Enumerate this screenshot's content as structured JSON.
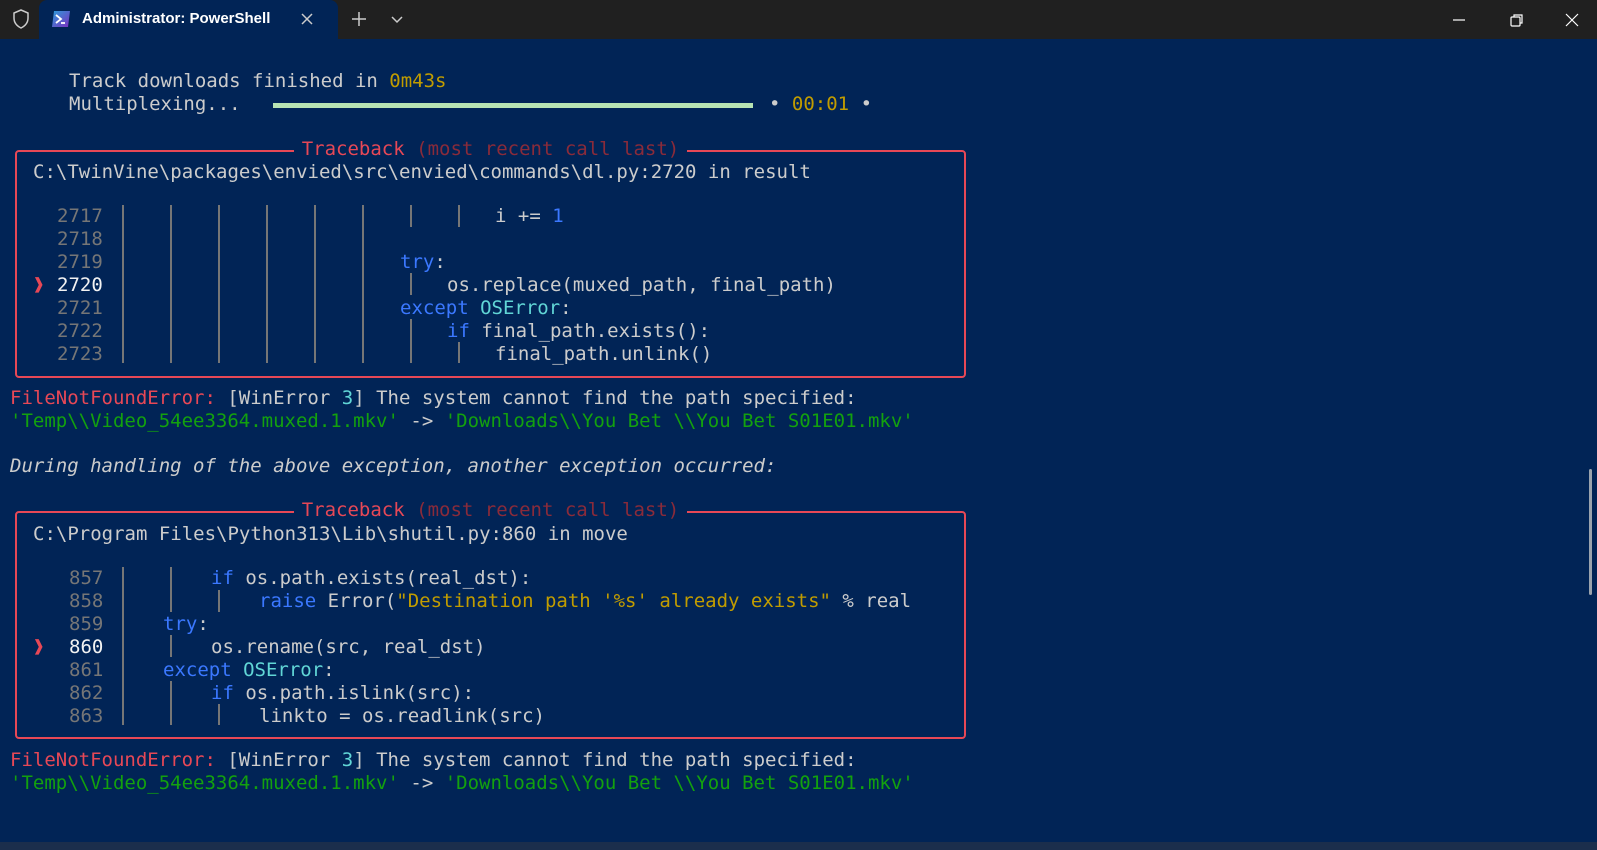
{
  "window": {
    "tab_title": "Administrator: PowerShell",
    "icons": {
      "shield": "shield-icon",
      "app": "powershell-icon",
      "close_tab": "close-icon",
      "new_tab": "plus-icon",
      "dropdown": "chevron-down-icon",
      "minimize": "minimize-icon",
      "restore": "restore-icon",
      "close_window": "close-icon"
    }
  },
  "colors": {
    "background": "#012456",
    "titlebar": "#202020",
    "error_red": "#e74856",
    "keyword_blue": "#3b78ff",
    "string_green": "#13a10e",
    "number_yellow": "#c19c00",
    "progress_fill": "#b7e4b3"
  },
  "output": {
    "track_downloads_prefix": "Track downloads finished in ",
    "track_downloads_time": "0m43s",
    "multiplexing_label": "Multiplexing...",
    "progress_percent": 100,
    "progress_bullet_left": "•",
    "progress_elapsed": "00:01",
    "progress_bullet_right": "•"
  },
  "tracebacks": [
    {
      "title": "Traceback",
      "subtitle": "(most recent call last)",
      "location": "C:\\TwinVine\\packages\\envied\\src\\envied\\commands\\dl.py:2720 in result",
      "lines": [
        {
          "num": "2717",
          "t1": "i += ",
          "t2": "1"
        },
        {
          "num": "2718"
        },
        {
          "num": "2719",
          "t1": "try",
          "t2": ":"
        },
        {
          "num": "2720",
          "marker": "❱",
          "t1": "os.replace(muxed_path, final_path)"
        },
        {
          "num": "2721",
          "t1": "except",
          "t2": " ",
          "t3": "OSError",
          "t4": ":"
        },
        {
          "num": "2722",
          "t1": "if",
          "t2": " final_path.exists():"
        },
        {
          "num": "2723",
          "t1": "final_path.unlink()"
        }
      ]
    },
    {
      "title": "Traceback",
      "subtitle": "(most recent call last)",
      "location": "C:\\Program Files\\Python313\\Lib\\shutil.py:860 in move",
      "lines": [
        {
          "num": "857",
          "t1": "if",
          "t2": " os.path.exists(real_dst):"
        },
        {
          "num": "858",
          "t1": "raise",
          "t2": " Error(",
          "t3": "\"Destination path '%s' already exists\"",
          "t4": " % real"
        },
        {
          "num": "859",
          "t1": "try",
          "t2": ":"
        },
        {
          "num": "860",
          "marker": "❱",
          "t1": "os.rename(src, real_dst)"
        },
        {
          "num": "861",
          "t1": "except",
          "t2": " ",
          "t3": "OSError",
          "t4": ":"
        },
        {
          "num": "862",
          "t1": "if",
          "t2": " os.path.islink(src):"
        },
        {
          "num": "863",
          "t1": "linkto = os.readlink(src)"
        }
      ]
    }
  ],
  "errors": [
    {
      "type": "FileNotFoundError:",
      "open": " [WinError ",
      "code": "3",
      "message": "] The system cannot find the path specified:",
      "src": "'Temp\\\\Video_54ee3364.muxed.1.mkv'",
      "arrow": " -> ",
      "dst": "'Downloads\\\\You Bet \\\\You Bet S01E01.mkv'"
    },
    {
      "type": "FileNotFoundError:",
      "open": " [WinError ",
      "code": "3",
      "message": "] The system cannot find the path specified:",
      "src": "'Temp\\\\Video_54ee3364.muxed.1.mkv'",
      "arrow": " -> ",
      "dst": "'Downloads\\\\You Bet \\\\You Bet S01E01.mkv'"
    }
  ],
  "during_handling": "During handling of the above exception, another exception occurred:"
}
